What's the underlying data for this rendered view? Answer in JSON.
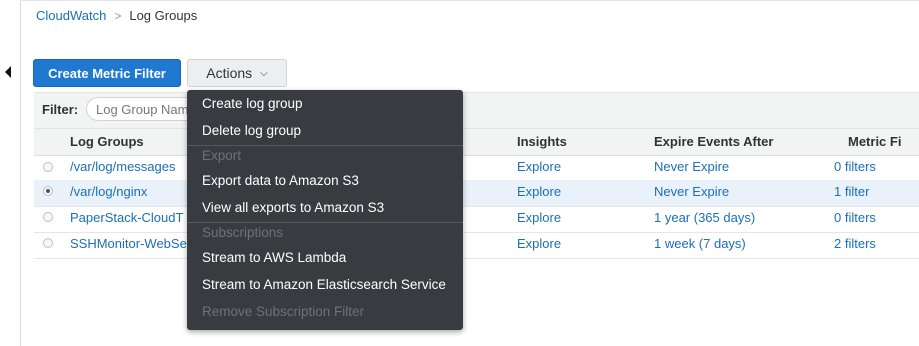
{
  "breadcrumb": {
    "root": "CloudWatch",
    "separator": ">",
    "current": "Log Groups"
  },
  "toolbar": {
    "create_metric_filter": "Create Metric Filter",
    "actions": "Actions"
  },
  "filter": {
    "label": "Filter:",
    "placeholder": "Log Group Nam"
  },
  "table": {
    "columns": [
      "Log Groups",
      "Insights",
      "Expire Events After",
      "Metric Fi"
    ],
    "rows": [
      {
        "name": "/var/log/messages",
        "insights": "Explore",
        "expire": "Never Expire",
        "metric": "0 filters",
        "selected": false
      },
      {
        "name": "/var/log/nginx",
        "insights": "Explore",
        "expire": "Never Expire",
        "metric": "1 filter",
        "selected": true
      },
      {
        "name": "PaperStack-CloudT",
        "insights": "Explore",
        "expire": "1 year (365 days)",
        "metric": "0 filters",
        "selected": false
      },
      {
        "name": "SSHMonitor-WebSe",
        "insights": "Explore",
        "expire": "1 week (7 days)",
        "metric": "2 filters",
        "selected": false
      }
    ]
  },
  "actions_menu": {
    "create_log_group": "Create log group",
    "delete_log_group": "Delete log group",
    "export_header": "Export",
    "export_s3": "Export data to Amazon S3",
    "view_exports": "View all exports to Amazon S3",
    "subscriptions_header": "Subscriptions",
    "stream_lambda": "Stream to AWS Lambda",
    "stream_es": "Stream to Amazon Elasticsearch Service",
    "remove_subscription": "Remove Subscription Filter"
  },
  "colors": {
    "primary": "#1f79d0",
    "link": "#1a6fb8",
    "menu_bg": "#383c40",
    "selected_row": "#e9f1fb"
  }
}
